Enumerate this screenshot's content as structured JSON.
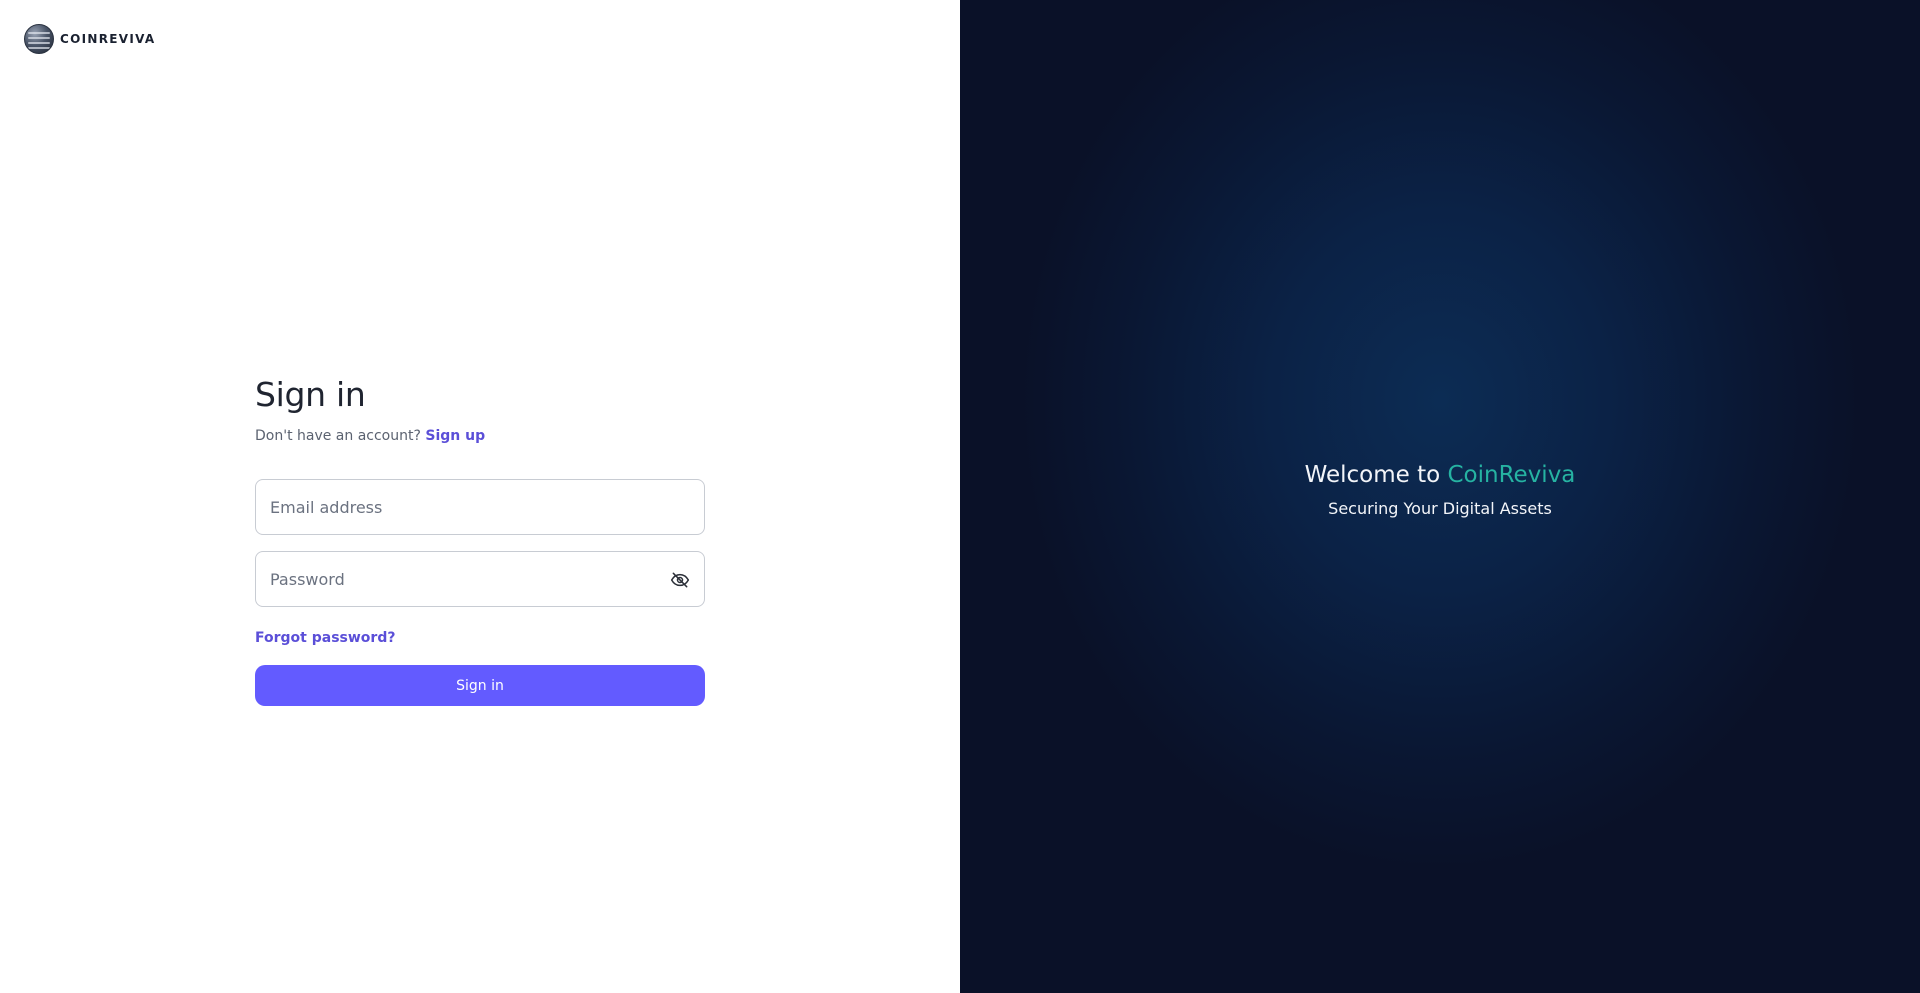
{
  "brand": {
    "logo_text": "COINREVIVA",
    "logo_icon": "coin-globe-icon"
  },
  "signin": {
    "title": "Sign in",
    "no_account_text": "Don't have an account?",
    "signup_link": "Sign up",
    "email": {
      "placeholder": "Email address",
      "value": ""
    },
    "password": {
      "placeholder": "Password",
      "value": "",
      "toggle_icon": "eye-off-icon"
    },
    "forgot_link": "Forgot password?",
    "submit_label": "Sign in"
  },
  "hero": {
    "welcome_prefix": "Welcome to",
    "welcome_brand": "CoinReviva",
    "tagline": "Securing Your Digital Assets"
  },
  "colors": {
    "accent": "#635bff",
    "link": "#5b4fd8",
    "brand_teal": "#26b3a2",
    "hero_bg": "#0a1128"
  }
}
